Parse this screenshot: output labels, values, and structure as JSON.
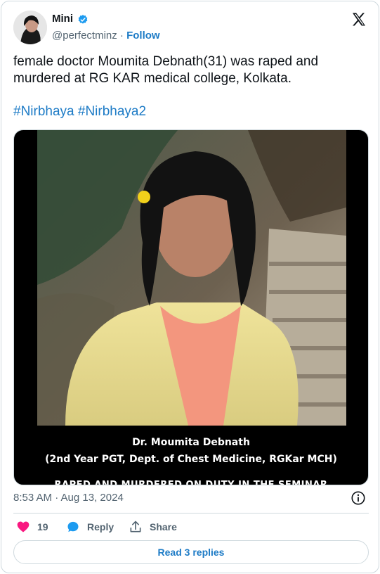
{
  "author": {
    "name": "Mini",
    "handle": "@perfectminz",
    "separator": " · ",
    "follow_label": "Follow"
  },
  "tweet": {
    "text": "female doctor Moumita Debnath(31) was raped and murdered at RG KAR medical college, Kolkata.",
    "hashtags": [
      "#Nirbhaya",
      "#Nirbhaya2"
    ]
  },
  "media": {
    "caption_name": "Dr. Moumita Debnath",
    "caption_sub": "(2nd Year PGT, Dept. of Chest Medicine, RGKar MCH)",
    "caption_cut": "RAPED AND MURDERED ON DUTY IN THE SEMINAR"
  },
  "footer": {
    "timestamp": "8:53 AM · Aug 13, 2024",
    "likes": "19",
    "reply_label": "Reply",
    "share_label": "Share",
    "read_replies": "Read 3 replies"
  },
  "colors": {
    "accent": "#1d7bc6",
    "like": "#f91880",
    "muted": "#536471",
    "border": "#cfd9de"
  },
  "icons": [
    "verified-badge-icon",
    "x-logo-icon",
    "info-icon",
    "heart-icon",
    "reply-icon",
    "share-icon"
  ]
}
